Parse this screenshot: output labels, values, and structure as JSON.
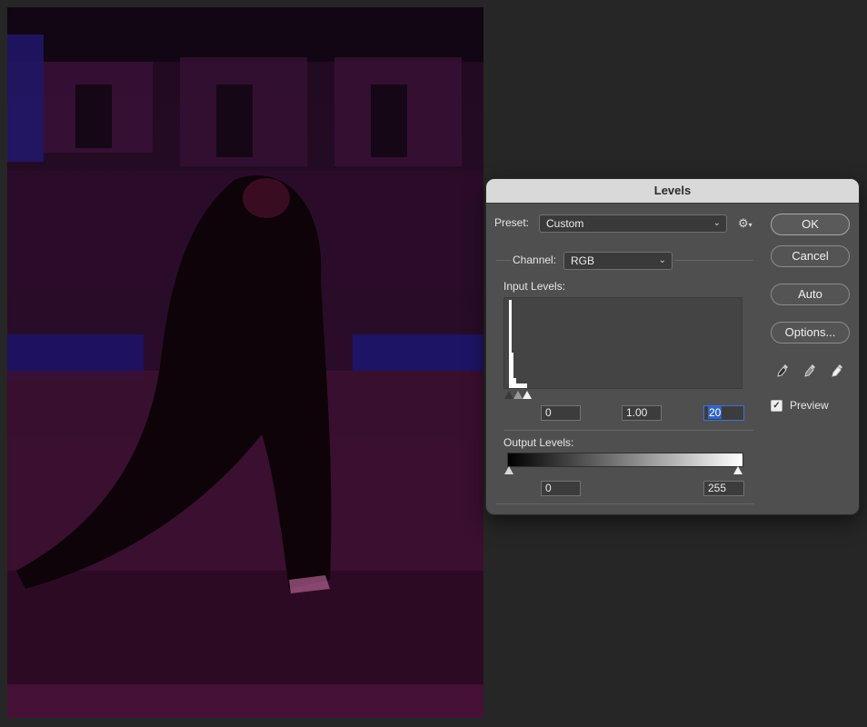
{
  "dialog": {
    "title": "Levels",
    "preset_label": "Preset:",
    "preset_value": "Custom",
    "channel_label": "Channel:",
    "channel_value": "RGB",
    "input_levels_label": "Input Levels:",
    "input_black": "0",
    "input_gamma": "1.00",
    "input_white": "20",
    "output_levels_label": "Output Levels:",
    "output_black": "0",
    "output_white": "255",
    "preview_label": "Preview",
    "preview_checked": true
  },
  "buttons": {
    "ok": "OK",
    "cancel": "Cancel",
    "auto": "Auto",
    "options": "Options..."
  },
  "icons": {
    "gear": "gear-icon",
    "chevron": "chevron-down-icon",
    "black_eyedropper": "eyedropper-black-icon",
    "gray_eyedropper": "eyedropper-gray-icon",
    "white_eyedropper": "eyedropper-white-icon",
    "checkmark": "checkmark-icon"
  },
  "colors": {
    "selection_accent": "#2f63c4"
  }
}
